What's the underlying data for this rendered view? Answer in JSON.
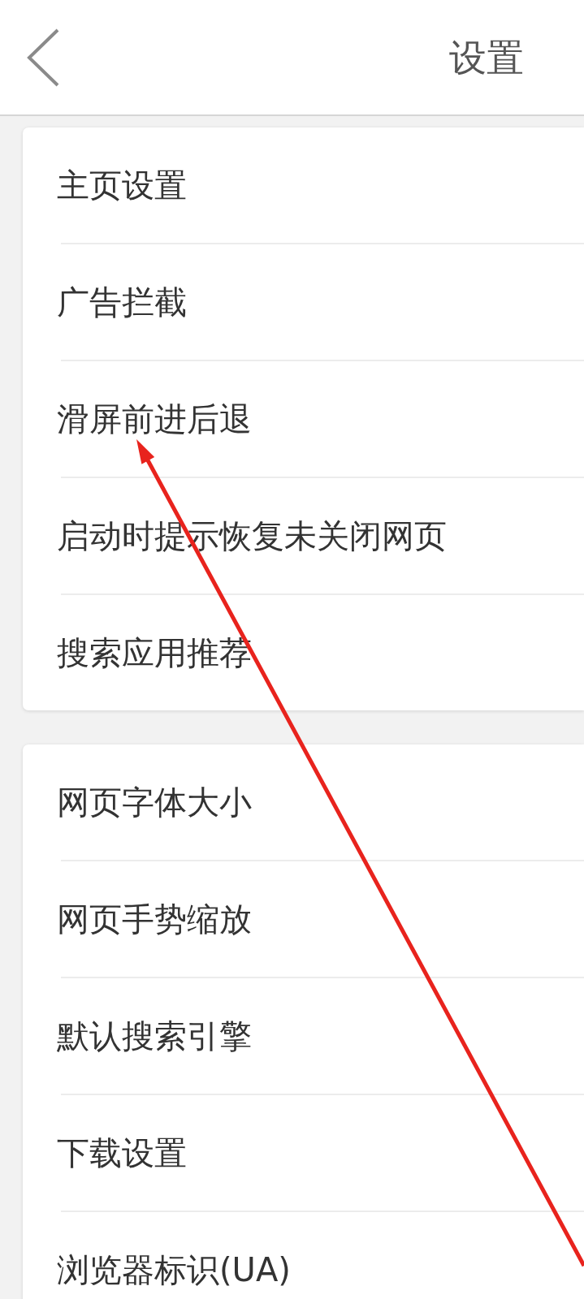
{
  "header": {
    "title": "设置"
  },
  "sections": [
    {
      "items": [
        {
          "label": "主页设置"
        },
        {
          "label": "广告拦截"
        },
        {
          "label": "滑屏前进后退"
        },
        {
          "label": "启动时提示恢复未关闭网页"
        },
        {
          "label": "搜索应用推荐"
        }
      ]
    },
    {
      "items": [
        {
          "label": "网页字体大小"
        },
        {
          "label": "网页手势缩放"
        },
        {
          "label": "默认搜索引擎"
        },
        {
          "label": "下载设置"
        },
        {
          "label": "浏览器标识(UA)"
        }
      ]
    }
  ]
}
